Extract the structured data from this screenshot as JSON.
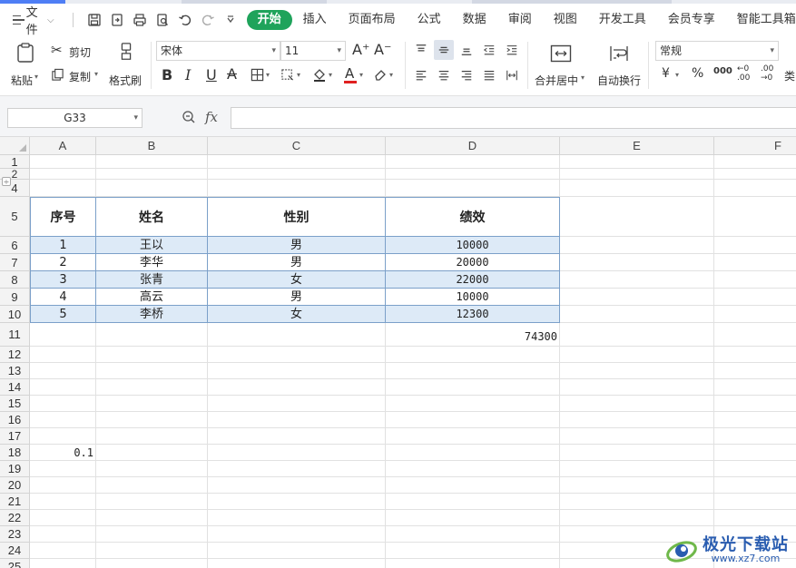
{
  "menu": {
    "file_label": "文件",
    "tabs": [
      "开始",
      "插入",
      "页面布局",
      "公式",
      "数据",
      "审阅",
      "视图",
      "开发工具",
      "会员专享",
      "智能工具箱"
    ],
    "active_tab": "开始"
  },
  "ribbon": {
    "paste": "粘贴",
    "cut": "剪切",
    "copy": "复制",
    "format_painter": "格式刷",
    "font_name": "宋体",
    "font_size": "11",
    "bold": "B",
    "italic": "I",
    "underline": "U",
    "merge_center": "合并居中",
    "wrap_text": "自动换行",
    "number_format": "常规",
    "currency": "¥",
    "percent": "%",
    "thousands": "000",
    "inc_decimal": "←0 .00",
    "dec_decimal": ".00 →0",
    "more": "类"
  },
  "formula_bar": {
    "name_box": "G33",
    "fx_label": "fx",
    "formula": ""
  },
  "sheet": {
    "columns": [
      "A",
      "B",
      "C",
      "D",
      "E",
      "F"
    ],
    "rows": [
      "1",
      "2",
      "4",
      "5",
      "6",
      "7",
      "8",
      "9",
      "10",
      "11",
      "12",
      "13",
      "14",
      "15",
      "16",
      "17",
      "18",
      "19",
      "20",
      "21",
      "22",
      "23",
      "24",
      "25"
    ],
    "table_headers": [
      "序号",
      "姓名",
      "性别",
      "绩效"
    ],
    "table_rows": [
      [
        "1",
        "王以",
        "男",
        "10000"
      ],
      [
        "2",
        "李华",
        "男",
        "20000"
      ],
      [
        "3",
        "张青",
        "女",
        "22000"
      ],
      [
        "4",
        "高云",
        "男",
        "10000"
      ],
      [
        "5",
        "李桥",
        "女",
        "12300"
      ]
    ],
    "sum_value": "74300",
    "a18_value": "0.1"
  },
  "watermark": {
    "title": "极光下载站",
    "url": "www.xz7.com"
  }
}
